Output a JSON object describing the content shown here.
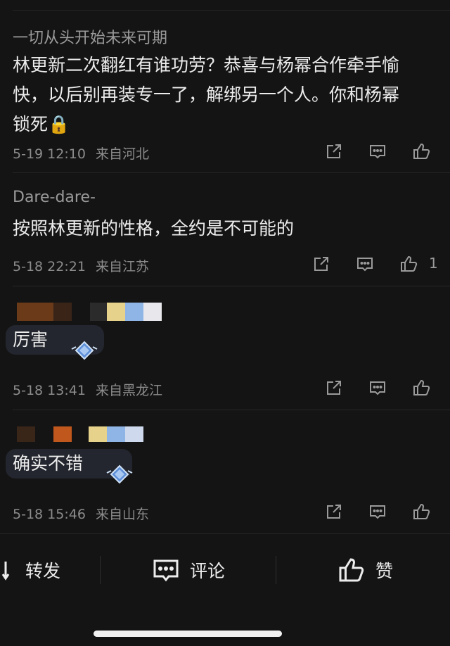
{
  "comments": [
    {
      "username": "一切从头开始未来可期",
      "content_lines": [
        "林更新二次翻红有谁功劳？恭喜与杨幂合作牵手愉",
        "快，以后别再装专一了，解绑另一个人。你和杨幂",
        "锁死🔒"
      ],
      "time": "5-19 12:10",
      "location": "来自河北",
      "likes": ""
    },
    {
      "username": "Dare-dare-",
      "content_lines": [
        "按照林更新的性格，全约是不可能的"
      ],
      "time": "5-18 22:21",
      "location": "来自江苏",
      "likes": "1"
    },
    {
      "username": "",
      "content_lines": [
        "厉害"
      ],
      "time": "5-18 13:41",
      "location": "来自黑龙江",
      "likes": ""
    },
    {
      "username": "",
      "content_lines": [
        "确实不错"
      ],
      "time": "5-18 15:46",
      "location": "来自山东",
      "likes": ""
    }
  ],
  "bottom_bar": {
    "repost": "转发",
    "comment": "评论",
    "like": "赞"
  },
  "icons": {
    "share": "share-icon",
    "reply": "comment-icon",
    "like": "thumbs-up-icon",
    "repost": "repost-icon"
  },
  "colors": {
    "background": "#141414",
    "text": "#ececec",
    "muted": "#8c8c8c"
  }
}
